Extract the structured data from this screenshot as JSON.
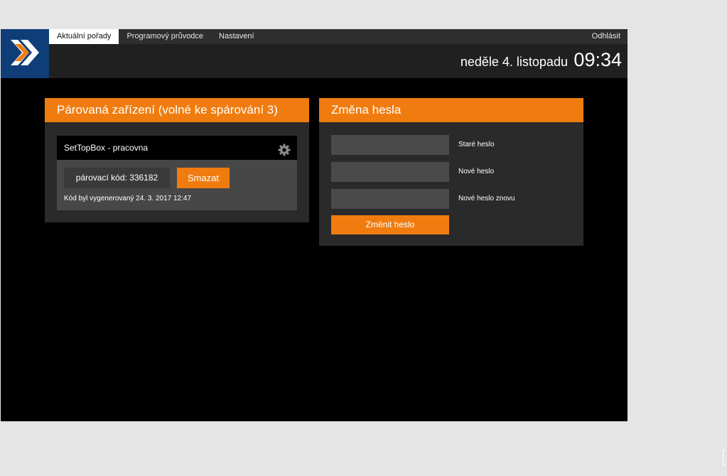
{
  "nav": {
    "tabs": [
      {
        "label": "Aktuální pořady"
      },
      {
        "label": "Programový průvodce"
      },
      {
        "label": "Nastavení"
      }
    ],
    "logout_label": "Odhlásit"
  },
  "header": {
    "date": "neděle 4. listopadu",
    "time": "09:34"
  },
  "devices_panel": {
    "title": "Párovaná zařízení (volné ke spárování 3)",
    "device": {
      "name": "SetTopBox - pracovna",
      "pairing_code": "párovací kód: 336182",
      "delete_label": "Smazat",
      "generated_note": "Kód byl vygenerovaný 24. 3. 2017 12:47"
    }
  },
  "password_panel": {
    "title": "Změna hesla",
    "fields": [
      {
        "label": "Staré heslo",
        "value": ""
      },
      {
        "label": "Nové heslo",
        "value": ""
      },
      {
        "label": "Nové heslo znovu",
        "value": ""
      }
    ],
    "submit_label": "Změnit heslo"
  },
  "colors": {
    "accent": "#f07c10",
    "logo_bg": "#0f3d78",
    "background": "#000000"
  },
  "icons": {
    "logo": "double-chevron-right-icon",
    "settings": "gear-icon"
  }
}
